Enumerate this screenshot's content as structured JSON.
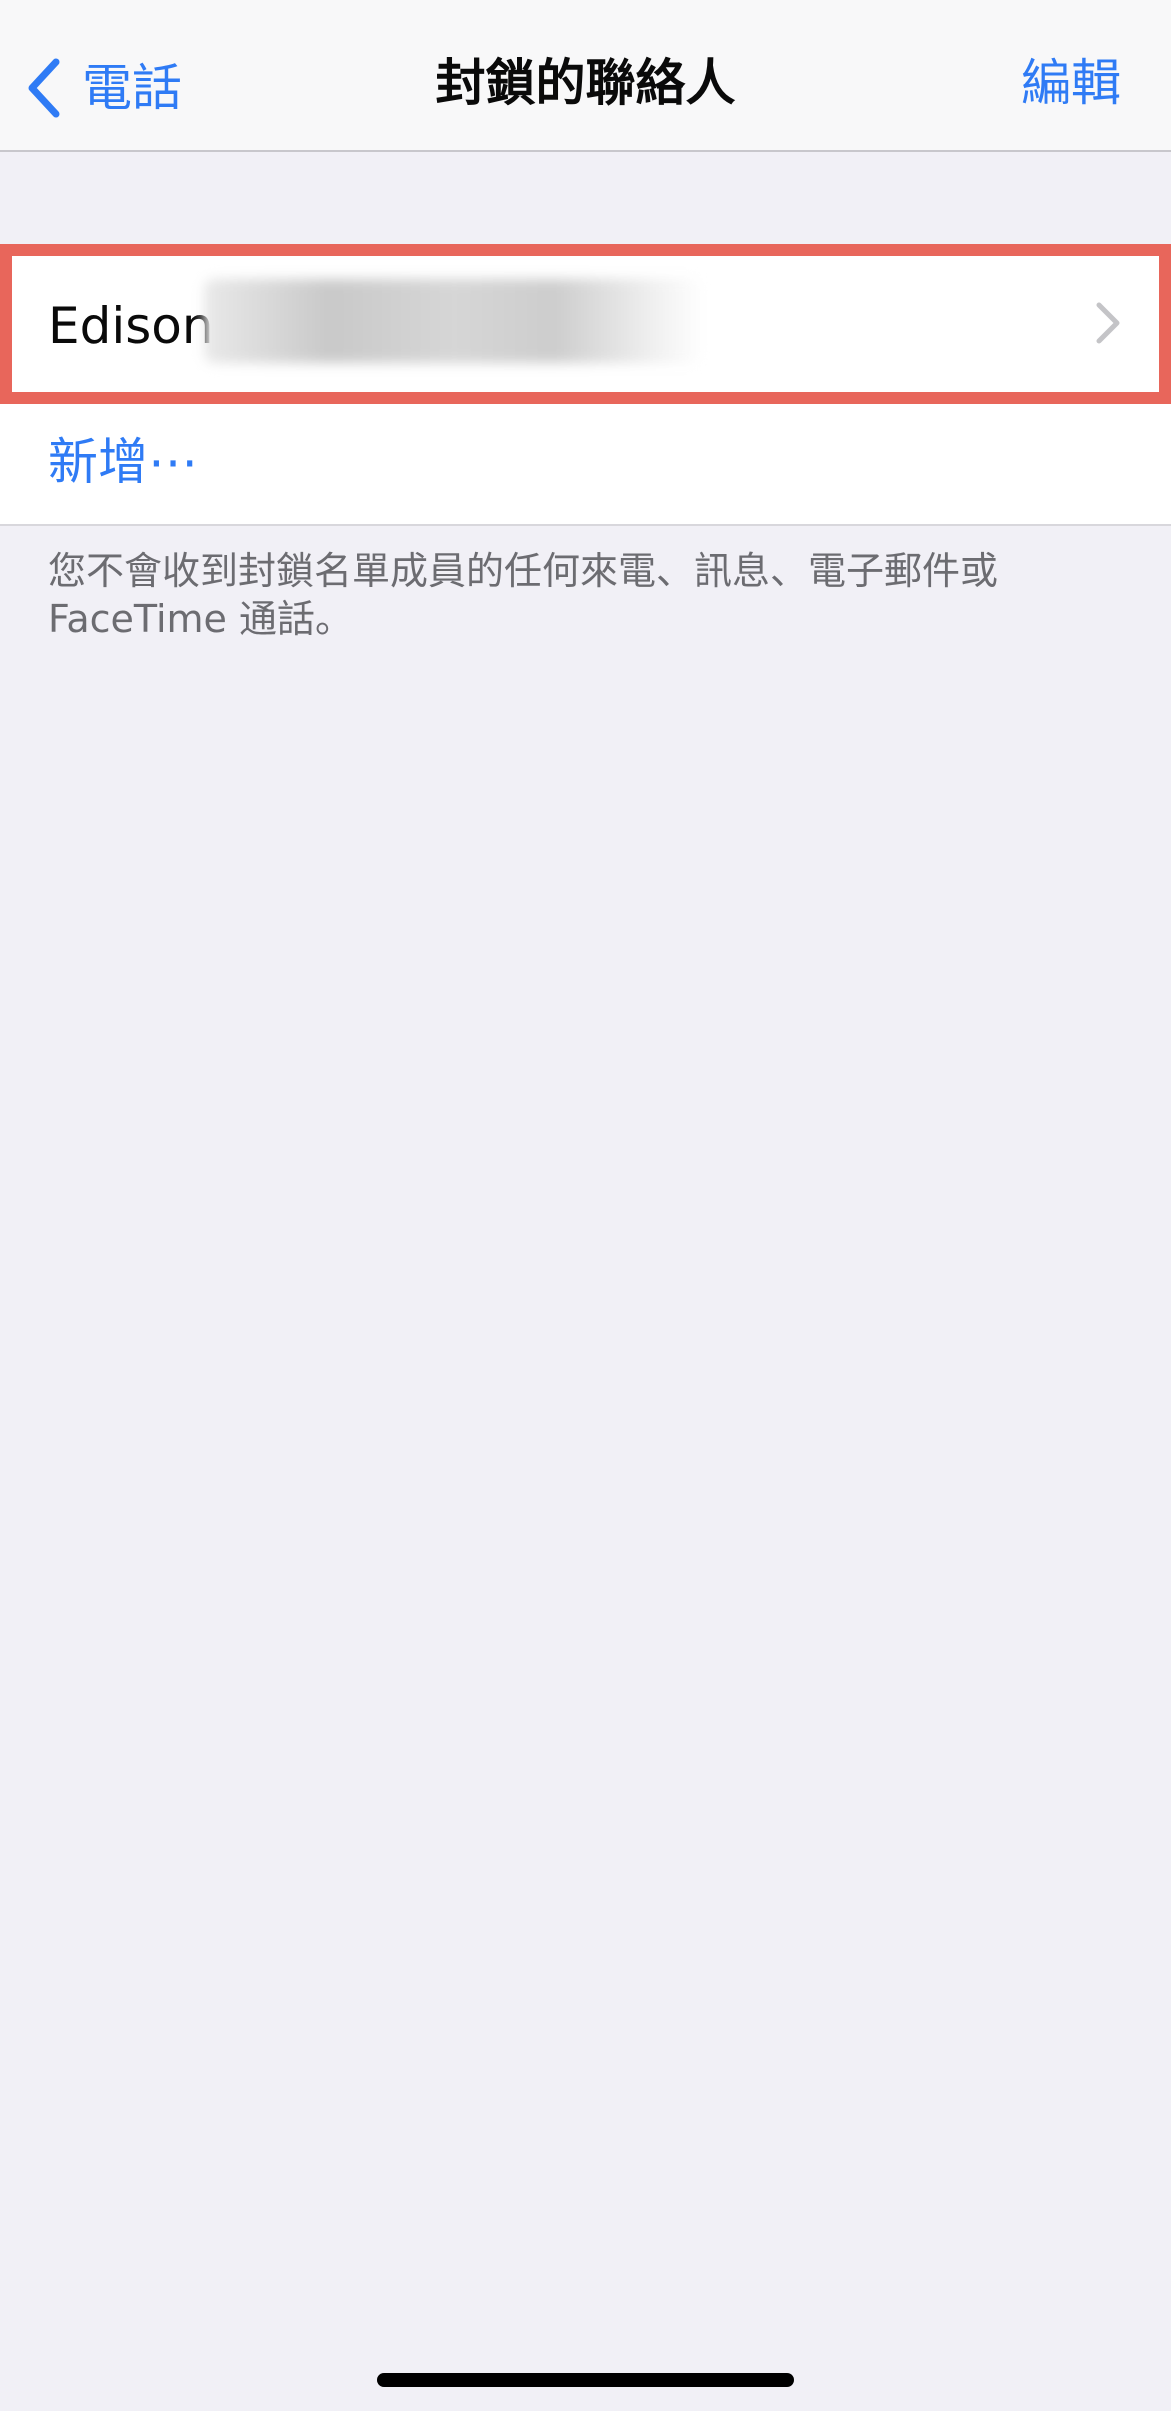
{
  "nav": {
    "back_label": "電話",
    "title": "封鎖的聯絡人",
    "edit_label": "編輯"
  },
  "blocked_list": {
    "items": [
      {
        "name": "Edison"
      }
    ],
    "add_label": "新增⋯"
  },
  "footer": {
    "note": "您不會收到封鎖名單成員的任何來電、訊息、電子郵件或FaceTime 通話。"
  },
  "colors": {
    "accent": "#2f7bf5",
    "highlight": "#e8665b",
    "background": "#f1f0f6"
  },
  "icons": {
    "back": "chevron-left-icon",
    "disclosure": "chevron-right-icon"
  }
}
